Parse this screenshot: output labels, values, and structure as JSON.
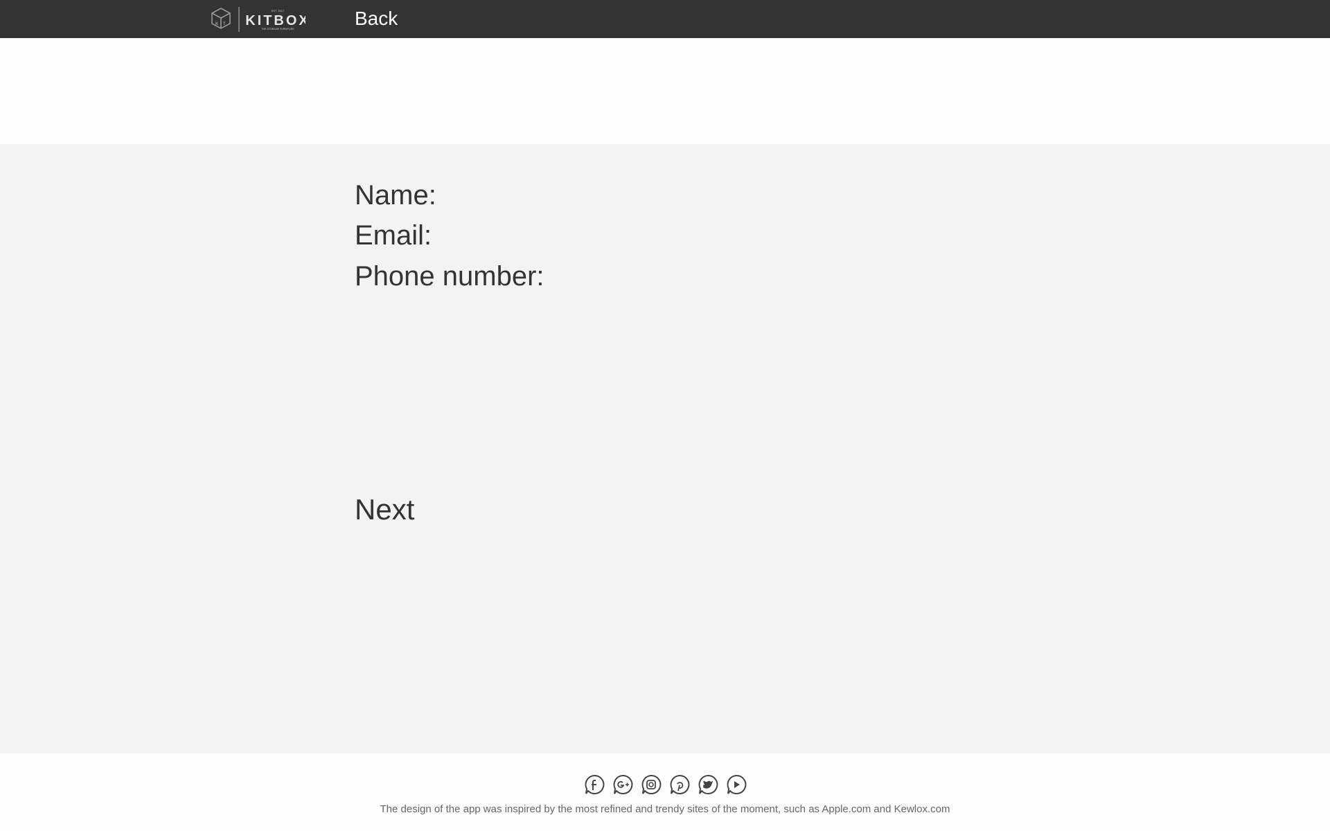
{
  "header": {
    "logo": {
      "brand": "KITBOX",
      "tagline": "THE STORAGE FURNITURE",
      "est": "EST. 2017"
    },
    "back_label": "Back"
  },
  "form": {
    "name_label": "Name:",
    "email_label": "Email:",
    "phone_label": "Phone number:",
    "next_label": "Next"
  },
  "footer": {
    "social_icons": [
      "facebook-icon",
      "google-plus-icon",
      "instagram-icon",
      "pinterest-icon",
      "twitter-icon",
      "youtube-icon"
    ],
    "credit": "The design of the app was inspired by the most refined and trendy sites of the moment, such as Apple.com and Kewlox.com"
  },
  "colors": {
    "topbar": "#333333",
    "main_bg": "#f3f3f3",
    "page_bg": "#fdfdfd",
    "text": "#333333"
  }
}
